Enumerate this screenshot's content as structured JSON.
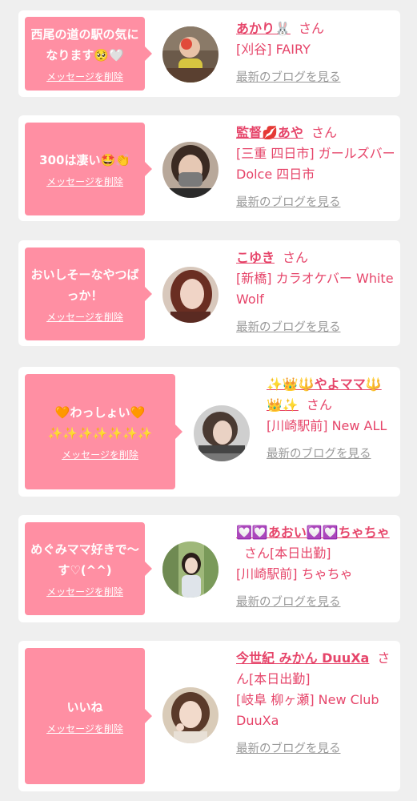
{
  "ui": {
    "delete_label": "メッセージを削除",
    "blog_label": "最新のブログを見る",
    "san": "さん"
  },
  "entries": [
    {
      "message": "西尾の道の駅の気になります🥺🤍",
      "name": "あかり🐰",
      "shop": "[刈谷] FAIRY"
    },
    {
      "message": "300は凄い🤩👏",
      "name": "監督💋あや",
      "shop": "[三重 四日市] ガールズバー Dolce 四日市"
    },
    {
      "message": "おいしそーなやつばっか！",
      "name": "こゆき",
      "shop": "[新橋] カラオケバー White Wolf"
    },
    {
      "message": "🧡わっしょい🧡 ✨✨✨✨✨✨✨",
      "name": "✨👑🔱やよママ🔱👑✨",
      "shop": "[川崎駅前] New ALL"
    },
    {
      "message": "めぐみママ好きで〜す♡(^^)",
      "name": "💟💟あおい💟💟ちゃちゃ",
      "name_suffix": "[本日出勤]",
      "shop": "[川崎駅前] ちゃちゃ"
    },
    {
      "message": "いいね",
      "name": "今世紀 みかん DuuXa",
      "name_suffix": "[本日出勤]",
      "shop": "[岐阜 柳ヶ瀬] New Club DuuXa"
    }
  ],
  "colors": {
    "bubble": "#ff8fa3",
    "name": "#e6456a",
    "link_gray": "#999999",
    "background": "#efefef"
  }
}
